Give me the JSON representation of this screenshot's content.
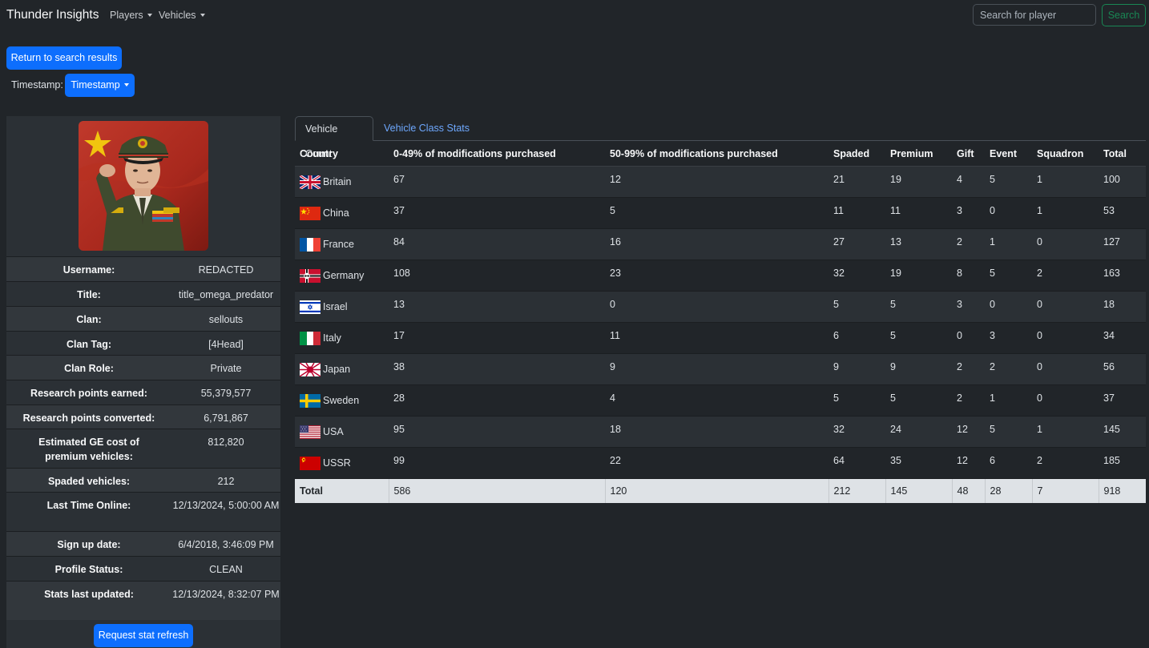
{
  "navbar": {
    "brand": "Thunder Insights",
    "menus": [
      "Players",
      "Vehicles"
    ],
    "search_placeholder": "Search for player",
    "search_button": "Search"
  },
  "controls": {
    "return_button": "Return to search results",
    "timestamp_label": "Timestamp:",
    "timestamp_button": "Timestamp"
  },
  "profile": {
    "rows": [
      {
        "label": "Username:",
        "value": "REDACTED"
      },
      {
        "label": "Title:",
        "value": "title_omega_predator"
      },
      {
        "label": "Clan:",
        "value": "sellouts"
      },
      {
        "label": "Clan Tag:",
        "value": "[4Head]"
      },
      {
        "label": "Clan Role:",
        "value": "Private"
      },
      {
        "label": "Research points earned:",
        "value": "55,379,577"
      },
      {
        "label": "Research points converted:",
        "value": "6,791,867"
      },
      {
        "label": "Estimated GE cost of premium vehicles:",
        "value": "812,820"
      },
      {
        "label": "Spaded vehicles:",
        "value": "212"
      },
      {
        "label": "Last Time Online:",
        "value": "12/13/2024, 5:00:00 AM"
      },
      {
        "label": "Sign up date:",
        "value": "6/4/2018, 3:46:09 PM"
      },
      {
        "label": "Profile Status:",
        "value": "CLEAN"
      },
      {
        "label": "Stats last updated:",
        "value": "12/13/2024, 8:32:07 PM"
      }
    ],
    "refresh_button": "Request stat refresh"
  },
  "tabs": [
    "Vehicle Count",
    "Vehicle Class Stats"
  ],
  "table": {
    "headers": [
      "Country",
      "0-49% of modifications purchased",
      "50-99% of modifications purchased",
      "Spaded",
      "Premium",
      "Gift",
      "Event",
      "Squadron",
      "Total"
    ],
    "rows": [
      {
        "country": "Britain",
        "flag": "uk-flag-icon",
        "cells": [
          "67",
          "12",
          "21",
          "19",
          "4",
          "5",
          "1",
          "100"
        ]
      },
      {
        "country": "China",
        "flag": "china-flag-icon",
        "cells": [
          "37",
          "5",
          "11",
          "11",
          "3",
          "0",
          "1",
          "53"
        ]
      },
      {
        "country": "France",
        "flag": "france-flag-icon",
        "cells": [
          "84",
          "16",
          "27",
          "13",
          "2",
          "1",
          "0",
          "127"
        ]
      },
      {
        "country": "Germany",
        "flag": "germany-flag-icon",
        "cells": [
          "108",
          "23",
          "32",
          "19",
          "8",
          "5",
          "2",
          "163"
        ]
      },
      {
        "country": "Israel",
        "flag": "israel-flag-icon",
        "cells": [
          "13",
          "0",
          "5",
          "5",
          "3",
          "0",
          "0",
          "18"
        ]
      },
      {
        "country": "Italy",
        "flag": "italy-flag-icon",
        "cells": [
          "17",
          "11",
          "6",
          "5",
          "0",
          "3",
          "0",
          "34"
        ]
      },
      {
        "country": "Japan",
        "flag": "japan-flag-icon",
        "cells": [
          "38",
          "9",
          "9",
          "9",
          "2",
          "2",
          "0",
          "56"
        ]
      },
      {
        "country": "Sweden",
        "flag": "sweden-flag-icon",
        "cells": [
          "28",
          "4",
          "5",
          "5",
          "2",
          "1",
          "0",
          "37"
        ]
      },
      {
        "country": "USA",
        "flag": "usa-flag-icon",
        "cells": [
          "95",
          "18",
          "32",
          "24",
          "12",
          "5",
          "1",
          "145"
        ]
      },
      {
        "country": "USSR",
        "flag": "ussr-flag-icon",
        "cells": [
          "99",
          "22",
          "64",
          "35",
          "12",
          "6",
          "2",
          "185"
        ]
      }
    ],
    "total_row": [
      "Total",
      "586",
      "120",
      "212",
      "145",
      "48",
      "28",
      "7",
      "918"
    ]
  },
  "colors": {
    "background": "#212529",
    "primary": "#0d6efd",
    "success": "#198754",
    "link": "#6ea8fe"
  }
}
